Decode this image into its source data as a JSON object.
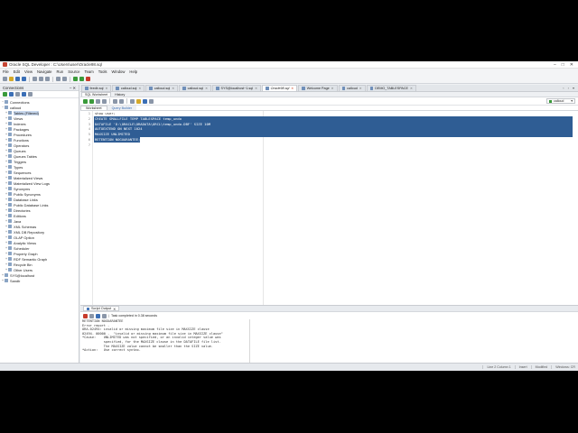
{
  "window": {
    "title": "Oracle SQL Developer : C:\\Users\\user\\Oracle98.sql"
  },
  "menu": [
    "File",
    "Edit",
    "View",
    "Navigate",
    "Run",
    "Source",
    "Team",
    "Tools",
    "Window",
    "Help"
  ],
  "left_panel": {
    "title": "Connections",
    "tree": [
      {
        "label": "Connections",
        "level": 0,
        "exp": "−"
      },
      {
        "label": "calloud",
        "level": 0,
        "exp": "−"
      },
      {
        "label": "Tables (Filtered)",
        "level": 1,
        "exp": "+",
        "selected": true
      },
      {
        "label": "Views",
        "level": 1,
        "exp": "+"
      },
      {
        "label": "Indexes",
        "level": 1,
        "exp": "+"
      },
      {
        "label": "Packages",
        "level": 1,
        "exp": "+"
      },
      {
        "label": "Procedures",
        "level": 1,
        "exp": "+"
      },
      {
        "label": "Functions",
        "level": 1,
        "exp": "+"
      },
      {
        "label": "Operators",
        "level": 1,
        "exp": "+"
      },
      {
        "label": "Queues",
        "level": 1,
        "exp": "+"
      },
      {
        "label": "Queues Tables",
        "level": 1,
        "exp": "+"
      },
      {
        "label": "Triggers",
        "level": 1,
        "exp": "+"
      },
      {
        "label": "Types",
        "level": 1,
        "exp": "+"
      },
      {
        "label": "Sequences",
        "level": 1,
        "exp": "+"
      },
      {
        "label": "Materialized Views",
        "level": 1,
        "exp": "+"
      },
      {
        "label": "Materialized View Logs",
        "level": 1,
        "exp": "+"
      },
      {
        "label": "Synonyms",
        "level": 1,
        "exp": "+"
      },
      {
        "label": "Public Synonyms",
        "level": 1,
        "exp": "+"
      },
      {
        "label": "Database Links",
        "level": 1,
        "exp": "+"
      },
      {
        "label": "Public Database Links",
        "level": 1,
        "exp": "+"
      },
      {
        "label": "Directories",
        "level": 1,
        "exp": "+"
      },
      {
        "label": "Editions",
        "level": 1,
        "exp": "+"
      },
      {
        "label": "Java",
        "level": 1,
        "exp": "+"
      },
      {
        "label": "XML Schemas",
        "level": 1,
        "exp": "+"
      },
      {
        "label": "XML DB Repository",
        "level": 1,
        "exp": "+"
      },
      {
        "label": "OLAP Option",
        "level": 1,
        "exp": "+"
      },
      {
        "label": "Analytic Views",
        "level": 1,
        "exp": "+"
      },
      {
        "label": "Scheduler",
        "level": 1,
        "exp": "+"
      },
      {
        "label": "Property Graph",
        "level": 1,
        "exp": "+"
      },
      {
        "label": "RDF Semantic Graph",
        "level": 1,
        "exp": "+"
      },
      {
        "label": "Recycle Bin",
        "level": 1,
        "exp": "+"
      },
      {
        "label": "Other Users",
        "level": 1,
        "exp": "+"
      },
      {
        "label": "SYS@localhost",
        "level": 0,
        "exp": "+"
      },
      {
        "label": "Sandb",
        "level": 0,
        "exp": "+"
      }
    ]
  },
  "doc_tabs": [
    {
      "label": "feedb.sql"
    },
    {
      "label": "calloud.sql"
    },
    {
      "label": "calloud.sql"
    },
    {
      "label": "calloud.sql"
    },
    {
      "label": "SYS@localhost~1.sql"
    },
    {
      "label": "Oracle98.sql",
      "active": true
    },
    {
      "label": "Welcome Page"
    },
    {
      "label": "calloud"
    },
    {
      "label": "DEMO_TABLESPACE"
    }
  ],
  "editor": {
    "sub_tabs": [
      "SQL Worksheet",
      "History"
    ],
    "inner_tabs": [
      "Worksheet",
      "Query Builder"
    ],
    "connection": "calloud",
    "gutter": [
      "1",
      "2",
      "3",
      "4",
      "5",
      "6",
      "7"
    ],
    "lines": [
      {
        "text": "show user;",
        "hl": false
      },
      {
        "text": "CREATE SMALLFILE TEMP TABLESPACE temp_undo",
        "hl": true
      },
      {
        "text": "DATAFILE 'D:\\ORACLE\\ORADATA\\ORCL\\temp_undo.DBF' SIZE 10M",
        "hl": true
      },
      {
        "text": "AUTOEXTEND ON NEXT 1024",
        "hl": true
      },
      {
        "text": "MAXSIZE UNLIMITED",
        "hl": true
      },
      {
        "text": "RETENTION NOGUARANTEE;",
        "hl": true,
        "last": true
      },
      {
        "text": "",
        "hl": false
      }
    ]
  },
  "output": {
    "tab_label": "Script Output",
    "status": "Task completed in 0.38 seconds",
    "lines": [
      "RETENTION NOGUARANTEE",
      "Error report -",
      "ORA-02494: invalid or missing maximum file size in MAXSIZE clause",
      "02494. 00000 -  \"invalid or missing maximum file size in MAXSIZE clause\"",
      "*Cause:    UNLIMITED was not specified, or an invalid integer value was",
      "           specified, for the MAXSIZE clause in the DATAFILE file list.",
      "           The MAXSIZE value cannot be smaller than the SIZE value.",
      "*Action:   Use correct syntax."
    ]
  },
  "status_bar": {
    "position": "Line 2 Column 1",
    "insert": "Insert",
    "modified": "Modified",
    "eol": "Windows: CR"
  }
}
